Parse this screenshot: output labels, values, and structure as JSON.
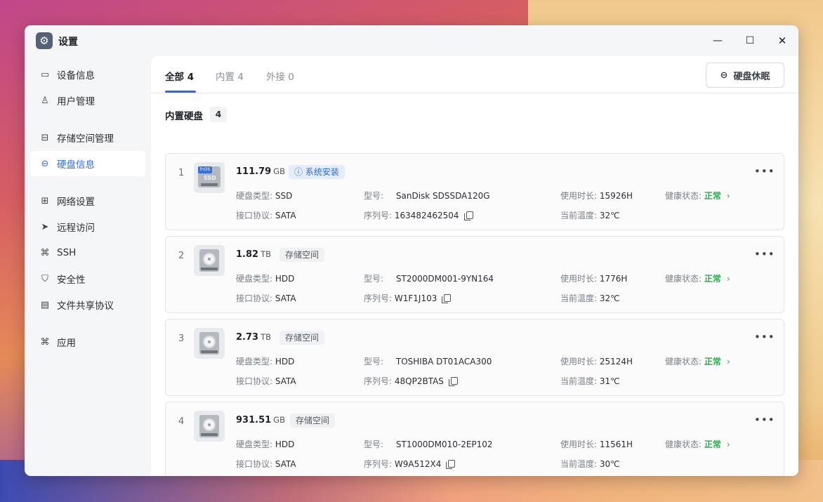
{
  "window": {
    "title": "设置",
    "app_icon": "gear-icon",
    "controls": {
      "minimize": "—",
      "maximize": "☐",
      "close": "✕"
    }
  },
  "sidebar": {
    "items": [
      {
        "label": "设备信息",
        "icon": "device-info-icon"
      },
      {
        "label": "用户管理",
        "icon": "user-icon"
      },
      {
        "label": "存储空间管理",
        "icon": "storage-icon"
      },
      {
        "label": "硬盘信息",
        "icon": "disk-icon",
        "active": true
      },
      {
        "label": "网络设置",
        "icon": "network-icon"
      },
      {
        "label": "远程访问",
        "icon": "send-icon"
      },
      {
        "label": "SSH",
        "icon": "code-icon"
      },
      {
        "label": "安全性",
        "icon": "shield-icon"
      },
      {
        "label": "文件共享协议",
        "icon": "file-icon"
      },
      {
        "label": "应用",
        "icon": "apps-icon"
      }
    ]
  },
  "tabs": [
    {
      "label": "全部",
      "count": "4",
      "active": true
    },
    {
      "label": "内置",
      "count": "4"
    },
    {
      "label": "外接",
      "count": "0"
    }
  ],
  "toolbar": {
    "sleep_label": "硬盘休眠"
  },
  "section": {
    "title": "内置硬盘",
    "count": "4"
  },
  "labels": {
    "type": "硬盘类型:",
    "interface": "接口协议:",
    "model": "型号:",
    "serial": "序列号:",
    "hours": "使用时长:",
    "temp": "当前温度:",
    "health": "健康状态:"
  },
  "disks": [
    {
      "index": "1",
      "size": "111.79",
      "unit": "GB",
      "kind": "ssd",
      "tag": "系统安装",
      "tag_style": "system",
      "ssd_brand": "fnOS",
      "ssd_label": "SSD",
      "type": "SSD",
      "interface": "SATA",
      "model": "SanDisk SDSSDA120G",
      "serial": "163482462504",
      "hours": "15926H",
      "temp": "32℃",
      "health": "正常"
    },
    {
      "index": "2",
      "size": "1.82",
      "unit": "TB",
      "kind": "hdd",
      "tag": "存储空间",
      "tag_style": "storage",
      "type": "HDD",
      "interface": "SATA",
      "model": "ST2000DM001-9YN164",
      "serial": "W1F1J103",
      "hours": "1776H",
      "temp": "32℃",
      "health": "正常"
    },
    {
      "index": "3",
      "size": "2.73",
      "unit": "TB",
      "kind": "hdd",
      "tag": "存储空间",
      "tag_style": "storage",
      "type": "HDD",
      "interface": "SATA",
      "model": "TOSHIBA DT01ACA300",
      "serial": "48QP2BTAS",
      "hours": "25124H",
      "temp": "31℃",
      "health": "正常"
    },
    {
      "index": "4",
      "size": "931.51",
      "unit": "GB",
      "kind": "hdd",
      "tag": "存储空间",
      "tag_style": "storage",
      "type": "HDD",
      "interface": "SATA",
      "model": "ST1000DM010-2EP102",
      "serial": "W9A512X4",
      "hours": "11561H",
      "temp": "30℃",
      "health": "正常"
    }
  ],
  "colors": {
    "accent": "#2d6be0",
    "health_ok": "#2fa84f"
  }
}
